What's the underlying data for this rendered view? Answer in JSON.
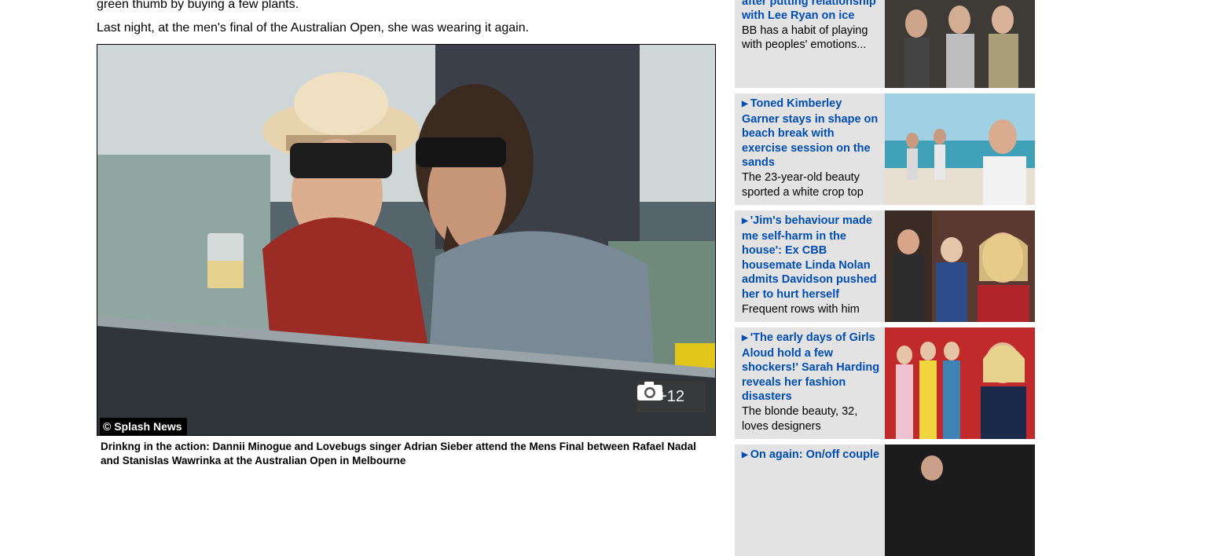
{
  "article": {
    "para1": "green thumb by buying a few plants.",
    "para2": "Last night, at the men's final of the Australian Open, she was wearing it again.",
    "image_credit": "© Splash News",
    "gallery_count": "+12",
    "caption": "Drinkng in the action: Dannii Minogue and Lovebugs singer Adrian Sieber attend the Mens Final between Rafael Nadal and Stanislas Wawrinka at the Australian Open in Melbourne"
  },
  "sidebar": {
    "stories": [
      {
        "title": "town with Duncan James after putting relationship with Lee Ryan on ice",
        "sub": "BB has a habit of playing with peoples' emotions...",
        "arrow": false
      },
      {
        "title": "Toned Kimberley Garner stays in shape on beach break with exercise session on the sands",
        "sub": "The 23-year-old beauty sported a white crop top",
        "arrow": true
      },
      {
        "title": "'Jim's behaviour made me self-harm in the house': Ex CBB housemate Linda Nolan admits Davidson pushed her to hurt herself",
        "sub": "Frequent rows with him",
        "arrow": true
      },
      {
        "title": "'The early days of Girls Aloud hold a few shockers!' Sarah Harding reveals her fashion disasters",
        "sub": "The blonde beauty, 32, loves designers",
        "arrow": true
      },
      {
        "title": "On again: On/off couple",
        "sub": "",
        "arrow": true
      }
    ]
  },
  "icons": {
    "camera": "camera-icon",
    "arrow": "right-arrow-icon"
  }
}
